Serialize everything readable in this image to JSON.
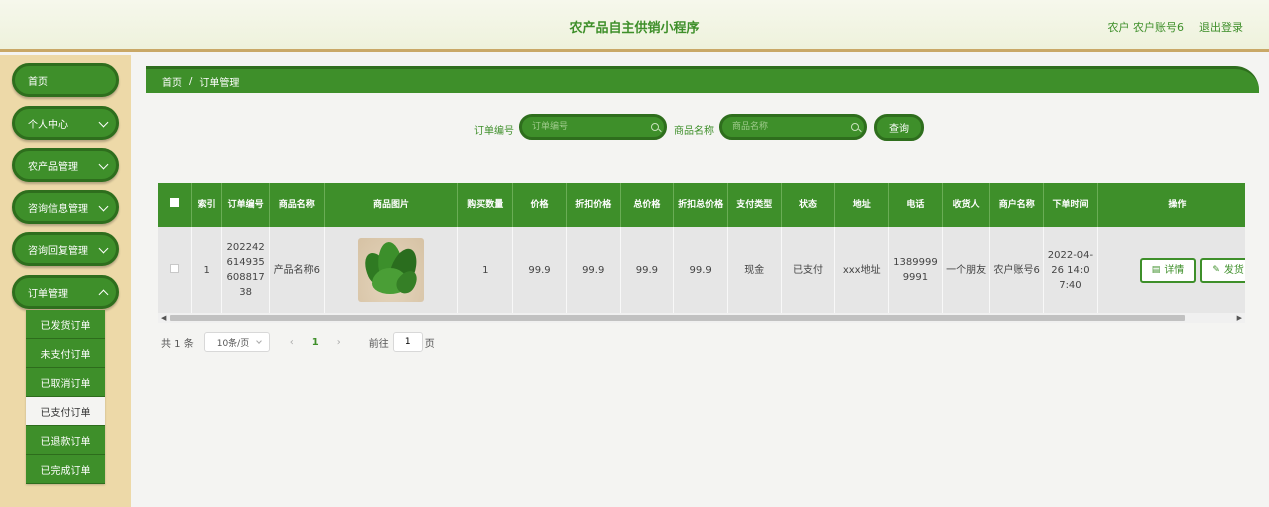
{
  "header": {
    "title": "农产品自主供销小程序",
    "user": "农户 农户账号6",
    "logout": "退出登录"
  },
  "sidebar": {
    "items": [
      {
        "label": "首页"
      },
      {
        "label": "个人中心"
      },
      {
        "label": "农产品管理"
      },
      {
        "label": "咨询信息管理"
      },
      {
        "label": "咨询回复管理"
      },
      {
        "label": "订单管理"
      }
    ],
    "submenu": [
      {
        "label": "已发货订单"
      },
      {
        "label": "未支付订单"
      },
      {
        "label": "已取消订单"
      },
      {
        "label": "已支付订单"
      },
      {
        "label": "已退款订单"
      },
      {
        "label": "已完成订单"
      }
    ]
  },
  "breadcrumb": {
    "home": "首页",
    "sep": "/",
    "current": "订单管理"
  },
  "search": {
    "order_label": "订单编号",
    "order_placeholder": "订单编号",
    "product_label": "商品名称",
    "product_placeholder": "商品名称",
    "button": "查询"
  },
  "table": {
    "headers": [
      "索引",
      "订单编号",
      "商品名称",
      "商品图片",
      "购买数量",
      "价格",
      "折扣价格",
      "总价格",
      "折扣总价格",
      "支付类型",
      "状态",
      "地址",
      "电话",
      "收货人",
      "商户名称",
      "下单时间",
      "操作"
    ],
    "row": {
      "index": "1",
      "order_no": "20224261493560881738",
      "product": "产品名称6",
      "qty": "1",
      "price": "99.9",
      "discount_price": "99.9",
      "total": "99.9",
      "discount_total": "99.9",
      "pay_type": "现金",
      "status": "已支付",
      "address": "xxx地址",
      "phone": "13899999991",
      "receiver": "一个朋友",
      "merchant": "农户账号6",
      "time": "2022-04-26 14:07:40",
      "actions": [
        "详情",
        "发货"
      ]
    }
  },
  "pager": {
    "total": "共 1 条",
    "page_size": "10条/页",
    "current": "1",
    "goto_label": "前往",
    "goto_value": "1",
    "page_suffix": "页"
  },
  "colors": {
    "primary": "#3e8f2a",
    "sidebar_bg": "#edd9a8",
    "header_bg": "#f2f5e4"
  }
}
